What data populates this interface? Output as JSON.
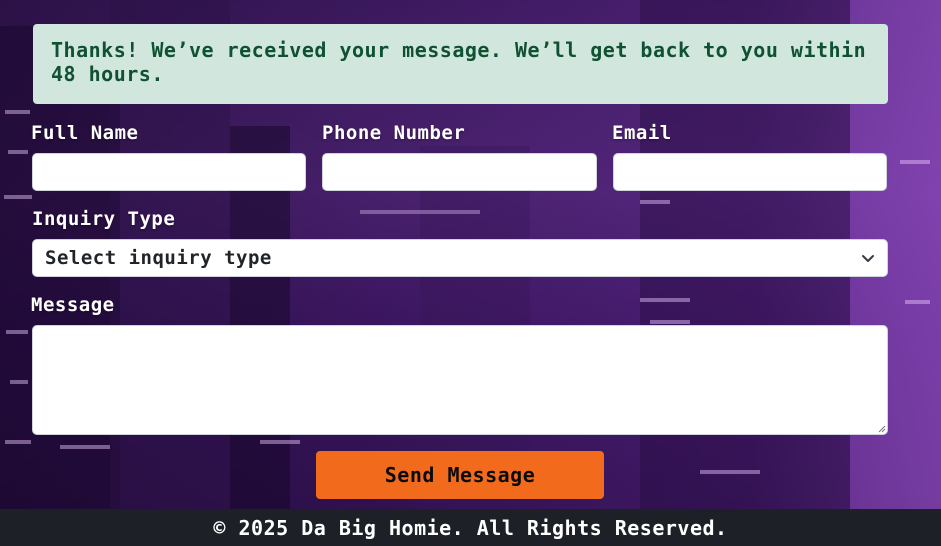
{
  "notice": {
    "text": "Thanks! We’ve received your message. We’ll get back to you within 48 hours."
  },
  "form": {
    "full_name_label": "Full Name",
    "full_name_value": "",
    "phone_label": "Phone Number",
    "phone_value": "",
    "email_label": "Email",
    "email_value": "",
    "inquiry_label": "Inquiry Type",
    "inquiry_selected": "Select inquiry type",
    "message_label": "Message",
    "message_value": "",
    "submit_label": "Send Message"
  },
  "footer": {
    "text": "© 2025 Da Big Homie. All Rights Reserved."
  },
  "colors": {
    "notice_bg": "#d1e7dd",
    "notice_text": "#0f5132",
    "button_bg": "#f26a1b",
    "footer_bg": "#1d2127"
  },
  "icons": {
    "select_arrow": "chevron-down-icon",
    "resize": "resize-grip-icon"
  }
}
